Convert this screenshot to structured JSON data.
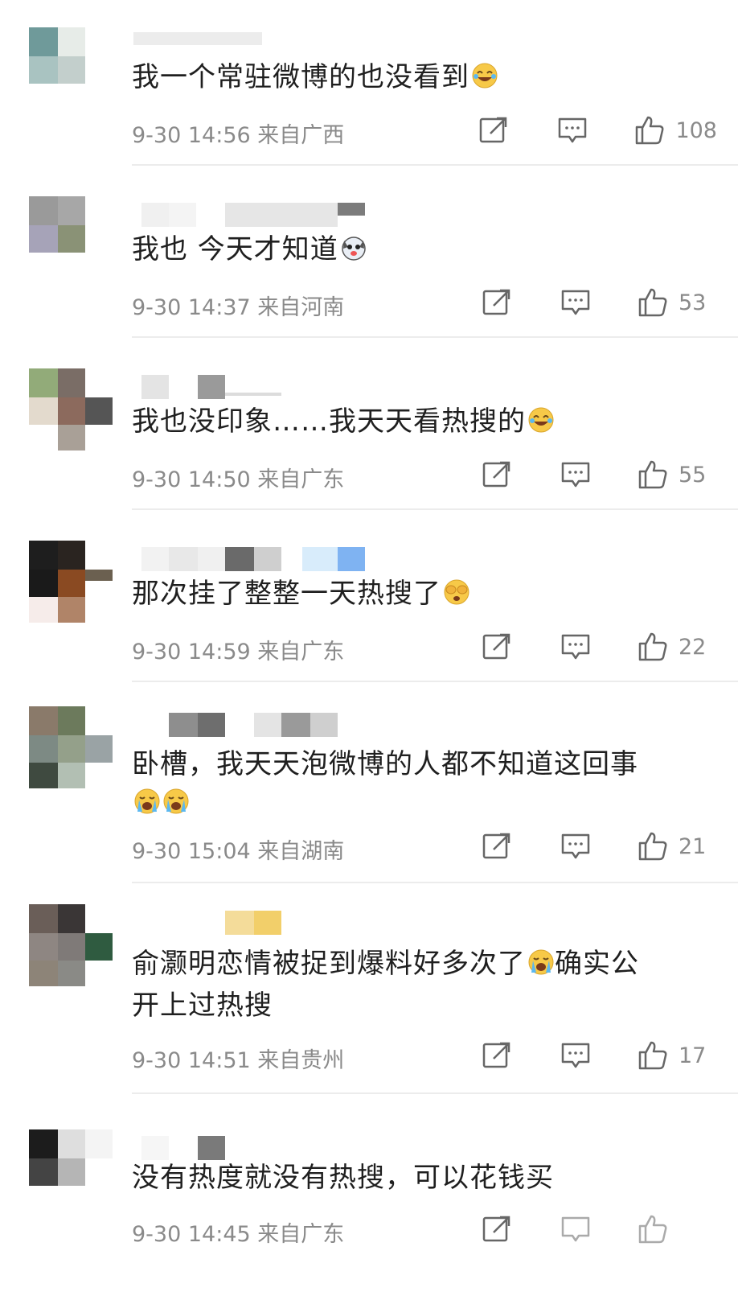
{
  "comments": [
    {
      "text": "我一个常驻微博的也没看到",
      "emoji": "laughing-tears-emoji",
      "text_line2": "",
      "time": "9-30 14:56",
      "location": "来自广西",
      "likes": "108"
    },
    {
      "text": "我也 今天才知道",
      "emoji": "husky-dog-emoji",
      "text_line2": "",
      "time": "9-30 14:37",
      "location": "来自河南",
      "likes": "53"
    },
    {
      "text": "我也没印象……我天天看热搜的",
      "emoji": "laughing-tears-emoji",
      "text_line2": "",
      "time": "9-30 14:50",
      "location": "来自广东",
      "likes": "55"
    },
    {
      "text": "那次挂了整整一天热搜了",
      "emoji": "covering-eyes-emoji",
      "text_line2": "",
      "time": "9-30 14:59",
      "location": "来自广东",
      "likes": "22"
    },
    {
      "text": "卧槽，我天天泡微博的人都不知道这回事",
      "emoji": "",
      "text_line2": "",
      "time": "9-30 15:04",
      "location": "来自湖南",
      "likes": "21"
    },
    {
      "text": "俞灏明恋情被捉到爆料好多次了",
      "emoji": "crying-emoji",
      "text_after": "确实公",
      "text_line2": "开上过热搜",
      "time": "9-30 14:51",
      "location": "来自贵州",
      "likes": "17"
    },
    {
      "text": "没有热度就没有热搜，可以花钱买",
      "emoji": "",
      "text_line2": "",
      "time": "9-30 14:45",
      "location": "来自广东",
      "likes": ""
    }
  ],
  "colors": {
    "meta_gray": "#8a8a8a",
    "divider": "#ececec",
    "emoji_yellow": "#f7c948"
  }
}
